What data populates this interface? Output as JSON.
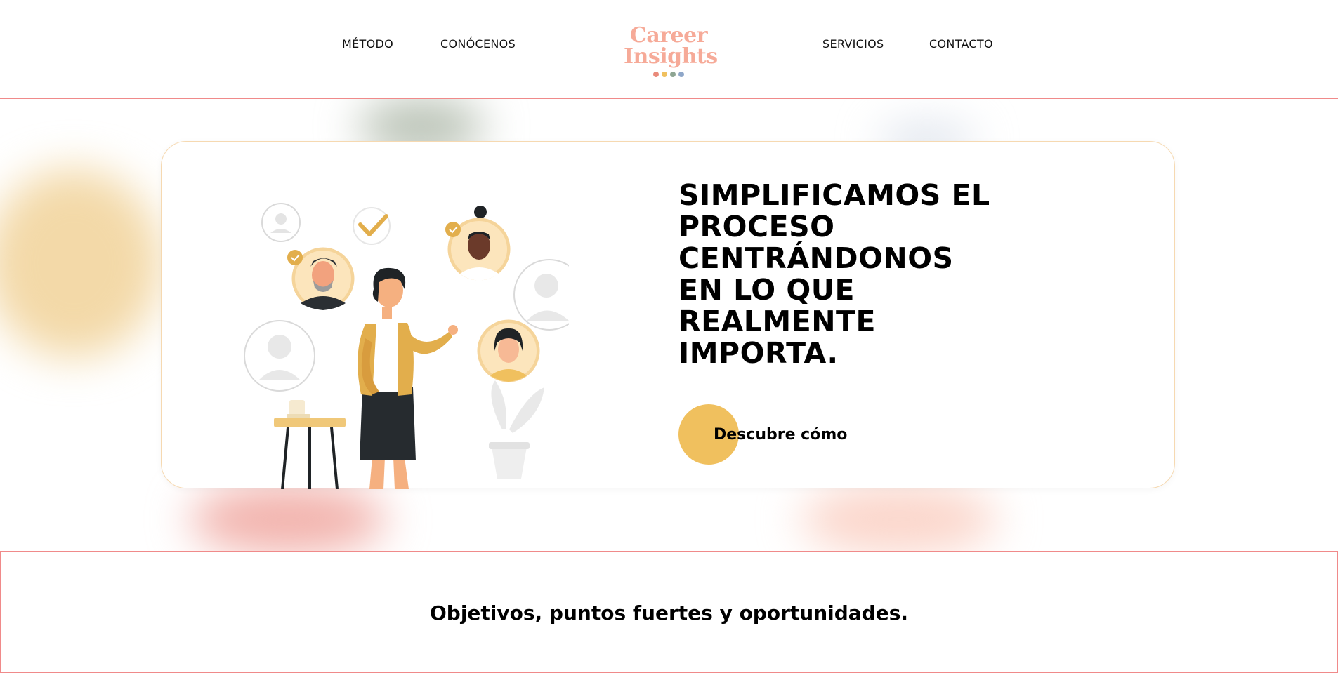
{
  "nav": {
    "metodo": "MÉTODO",
    "conocenos": "CONÓCENOS",
    "servicios": "SERVICIOS",
    "contacto": "CONTACTO"
  },
  "logo": {
    "line1": "Career",
    "line2": "Insights",
    "dot_colors": [
      "#e98a7a",
      "#f0c05e",
      "#8ea593",
      "#8fa7c9"
    ]
  },
  "hero": {
    "title": "SIMPLIFICAMOS EL PROCESO CENTRÁNDONOS EN LO QUE REALMENTE IMPORTA.",
    "cta_label": "Descubre cómo",
    "illustration_icon": "person-presenting-candidates-illustration"
  },
  "section_two": {
    "heading": "Objetivos, puntos fuertes y oportunidades."
  },
  "colors": {
    "accent_yellow": "#f0c05e",
    "line_red": "#f08a8a",
    "logo_salmon": "#f6aa98"
  }
}
